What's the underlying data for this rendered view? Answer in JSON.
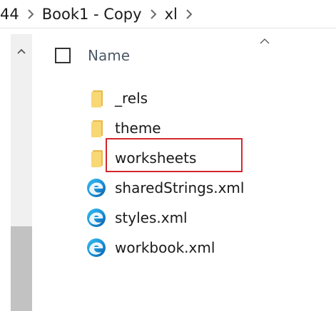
{
  "breadcrumb": {
    "items": [
      "44",
      "Book1 - Copy",
      "xl"
    ]
  },
  "column_header": {
    "name_label": "Name"
  },
  "files": [
    {
      "name": "_rels",
      "icon": "folder-icon"
    },
    {
      "name": "theme",
      "icon": "folder-icon"
    },
    {
      "name": "worksheets",
      "icon": "folder-icon",
      "highlighted": true
    },
    {
      "name": "sharedStrings.xml",
      "icon": "edge-xml-icon"
    },
    {
      "name": "styles.xml",
      "icon": "edge-xml-icon"
    },
    {
      "name": "workbook.xml",
      "icon": "edge-xml-icon"
    }
  ],
  "colors": {
    "highlight": "#d4272d",
    "folder": "#f8d775",
    "header_text": "#4b5968",
    "scroll_thumb": "#c2c2c2"
  }
}
